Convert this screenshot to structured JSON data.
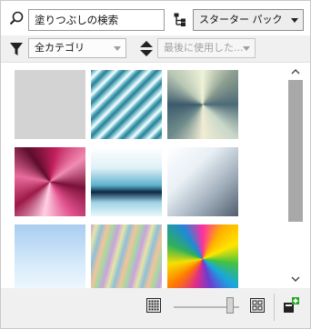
{
  "search": {
    "value": "塗りつぶしの検索"
  },
  "pack_selector": {
    "value": "スターター パック"
  },
  "filter": {
    "category_value": "全カテゴリ"
  },
  "sort": {
    "value": "最後に使用した..."
  },
  "colors": {
    "accent_green": "#22aa22",
    "thumb": "#a8a8a8"
  },
  "tiles": [
    {
      "name": "flat-gray-fill"
    },
    {
      "name": "teal-diagonal-stripes"
    },
    {
      "name": "silver-conical"
    },
    {
      "name": "magenta-conical"
    },
    {
      "name": "blue-chrome-linear"
    },
    {
      "name": "silver-linear"
    },
    {
      "name": "sky-blue-linear"
    },
    {
      "name": "pastel-rainbow-stripes"
    },
    {
      "name": "rainbow-conical"
    }
  ]
}
